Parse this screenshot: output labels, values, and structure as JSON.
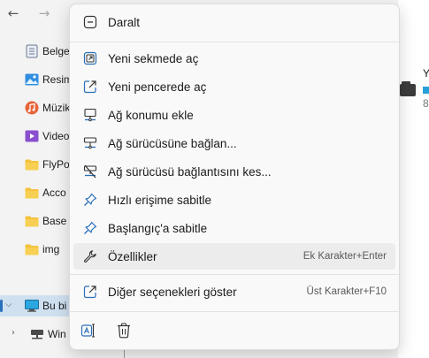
{
  "explorer": {
    "back_glyph": "←",
    "forward_glyph": "→",
    "tree_items": [
      {
        "label": "Belge",
        "icon": "document-icon"
      },
      {
        "label": "Resim",
        "icon": "pictures-icon"
      },
      {
        "label": "Müzik",
        "icon": "music-icon"
      },
      {
        "label": "Video",
        "icon": "videos-icon"
      },
      {
        "label": "FlyPo",
        "icon": "folder-icon"
      },
      {
        "label": "Acco",
        "icon": "folder-icon"
      },
      {
        "label": "Base",
        "icon": "folder-icon"
      },
      {
        "label": "img",
        "icon": "folder-icon"
      },
      {
        "label": "Bu bi",
        "icon": "this-pc-icon"
      },
      {
        "label": "Win",
        "icon": "network-drive-icon"
      }
    ],
    "right_pane": {
      "y_letter": "Y",
      "size_digit": "8"
    }
  },
  "context_menu": {
    "items": [
      {
        "label": "Daralt",
        "icon": "collapse-icon"
      },
      {
        "label": "Yeni sekmede aç",
        "icon": "open-new-tab-icon"
      },
      {
        "label": "Yeni pencerede aç",
        "icon": "open-new-window-icon"
      },
      {
        "label": "Ağ konumu ekle",
        "icon": "add-network-location-icon"
      },
      {
        "label": "Ağ sürücüsüne bağlan...",
        "icon": "map-network-drive-icon"
      },
      {
        "label": "Ağ sürücüsü bağlantısını kes...",
        "icon": "disconnect-network-drive-icon"
      },
      {
        "label": "Hızlı erişime sabitle",
        "icon": "pin-icon"
      },
      {
        "label": "Başlangıç'a sabitle",
        "icon": "pin-icon"
      },
      {
        "label": "Özellikler",
        "icon": "wrench-icon",
        "shortcut": "Ek Karakter+Enter"
      },
      {
        "label": "Diğer seçenekleri göster",
        "icon": "show-more-options-icon",
        "shortcut": "Üst Karakter+F10"
      }
    ],
    "bottom_actions": [
      {
        "name": "rename",
        "icon": "rename-icon"
      },
      {
        "name": "delete",
        "icon": "trash-icon"
      }
    ]
  },
  "colors": {
    "accent": "#2a6fba",
    "folder": "#f4c23d",
    "menu_bg": "#f9f9f9",
    "hover_bg": "#ececec",
    "selection_bg": "#cfe0f0"
  }
}
